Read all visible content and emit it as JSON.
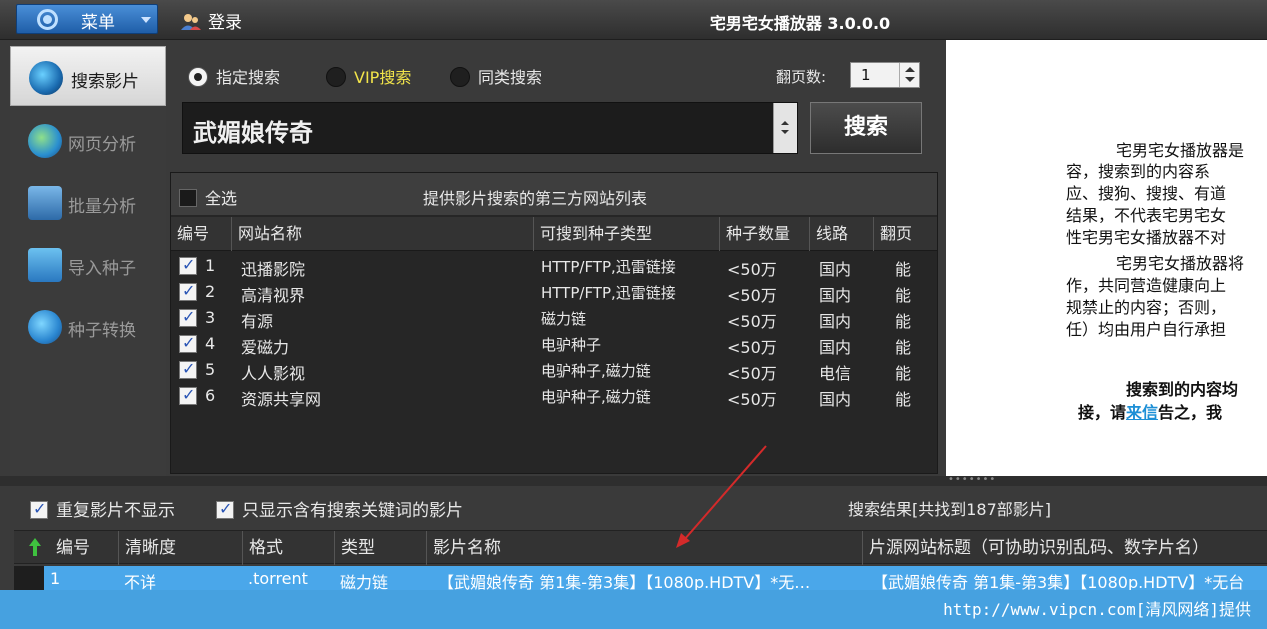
{
  "titlebar": {
    "menu_label": "菜单",
    "login_label": "登录",
    "app_title": "宅男宅女播放器 3.0.0.0"
  },
  "sidebar": {
    "items": [
      {
        "label": "搜索影片",
        "icon": "search-film-icon"
      },
      {
        "label": "网页分析",
        "icon": "globe-icon"
      },
      {
        "label": "批量分析",
        "icon": "batch-icon"
      },
      {
        "label": "导入种子",
        "icon": "import-icon"
      },
      {
        "label": "种子转换",
        "icon": "convert-icon"
      }
    ]
  },
  "search": {
    "modes": [
      {
        "label": "指定搜索",
        "checked": true
      },
      {
        "label": "VIP搜索",
        "checked": false
      },
      {
        "label": "同类搜索",
        "checked": false
      }
    ],
    "pages_label": "翻页数:",
    "pages_value": "1",
    "keyword": "武媚娘传奇",
    "search_button": "搜索"
  },
  "sites": {
    "select_all": "全选",
    "caption": "提供影片搜索的第三方网站列表",
    "columns": [
      "编号",
      "网站名称",
      "可搜到种子类型",
      "种子数量",
      "线路",
      "翻页"
    ],
    "rows": [
      {
        "id": "1",
        "name": "迅播影院",
        "type": "HTTP/FTP,迅雷链接",
        "count": "<50万",
        "line": "国内",
        "paging": "能"
      },
      {
        "id": "2",
        "name": "高清视界",
        "type": "HTTP/FTP,迅雷链接",
        "count": "<50万",
        "line": "国内",
        "paging": "能"
      },
      {
        "id": "3",
        "name": "有源",
        "type": "磁力链",
        "count": "<50万",
        "line": "国内",
        "paging": "能"
      },
      {
        "id": "4",
        "name": "爱磁力",
        "type": "电驴种子",
        "count": "<50万",
        "line": "国内",
        "paging": "能"
      },
      {
        "id": "5",
        "name": "人人影视",
        "type": "电驴种子,磁力链",
        "count": "<50万",
        "line": "电信",
        "paging": "能"
      },
      {
        "id": "6",
        "name": "资源共享网",
        "type": "电驴种子,磁力链",
        "count": "<50万",
        "line": "国内",
        "paging": "能"
      }
    ]
  },
  "notice": {
    "lines": [
      "宅男宅女播放器是",
      "容，搜索到的内容系",
      "应、搜狗、搜搜、有道",
      "结果，不代表宅男宅女",
      "性宅男宅女播放器不对",
      "宅男宅女播放器将",
      "作，共同营造健康向上",
      "规禁止的内容；否则，",
      "任）均由用户自行承担"
    ],
    "bold_line1": "搜索到的内容均",
    "bold_line2_pre": "接，请",
    "bold_line2_link": "来信",
    "bold_line2_post": "告之，我"
  },
  "results": {
    "opt_nodup": "重复影片不显示",
    "opt_keyword": "只显示含有搜索关键词的影片",
    "count_text": "搜索结果[共找到187部影片]",
    "columns": [
      "编号",
      "清晰度",
      "格式",
      "类型",
      "影片名称",
      "片源网站标题（可协助识别乱码、数字片名）"
    ],
    "rows": [
      {
        "id": "1",
        "quality": "不详",
        "format": ".torrent",
        "type": "磁力链",
        "name": "【武媚娘传奇 第1集-第3集】【1080p.HDTV】*无…",
        "source": "【武媚娘传奇 第1集-第3集】【1080p.HDTV】*无台"
      }
    ]
  },
  "footer": {
    "watermark": "http://www.vipcn.com[清风网络]提供"
  },
  "colors": {
    "accent_blue": "#4aa7ea",
    "vip_yellow": "#f2e44a",
    "menu_blue": "#1f5ea8",
    "arrow_red": "#d42a2a"
  }
}
